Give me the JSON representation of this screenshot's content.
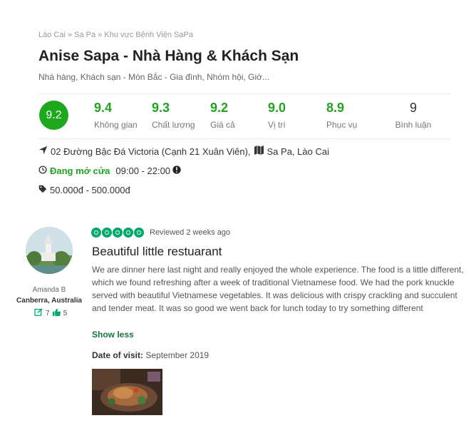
{
  "breadcrumb": {
    "items": [
      "Lào Cai",
      "Sa Pa",
      "Khu vực Bệnh Viện SaPa"
    ],
    "sep": " » "
  },
  "restaurant": {
    "title": "Anise Sapa - Nhà Hàng & Khách Sạn",
    "categories": "Nhà hàng, Khách sạn - Món Bắc - Gia đình, Nhóm hội, Giớ..."
  },
  "ratings": {
    "overall": "9.2",
    "items": [
      {
        "value": "9.4",
        "label": "Không gian"
      },
      {
        "value": "9.3",
        "label": "Chất lượng"
      },
      {
        "value": "9.2",
        "label": "Giá cả"
      },
      {
        "value": "9.0",
        "label": "Vị trí"
      },
      {
        "value": "8.9",
        "label": "Phục vụ"
      },
      {
        "value": "9",
        "label": "Bình luận"
      }
    ],
    "accent_color": "#22a322"
  },
  "info": {
    "address": "02 Đường Bậc Đá Victoria (Cạnh 21 Xuân Viên),",
    "city": "Sa Pa, Lào Cai",
    "status": "Đang mở cửa",
    "hours": "09:00 - 22:00",
    "price": "50.000đ - 500.000đ"
  },
  "review": {
    "user_name": "Amanda B",
    "user_location": "Canberra, Australia",
    "user_reviews": "7",
    "user_helpful": "5",
    "rating_bubbles": 5,
    "reviewed": "Reviewed 2 weeks ago",
    "title": "Beautiful little restuarant",
    "body": "We are dinner here last night and really enjoyed the whole experience. The food is a little different, which we found refreshing after a week of traditional Vietnamese food. We had the pork knuckle served with beautiful Vietnamese vegetables. It was delicious with crispy crackling and succulent and tender meat. It was so good we went back for lunch today to try something different",
    "show_less": "Show less",
    "visit_label": "Date of visit:",
    "visit_date": "September 2019",
    "bubble_color": "#00aa6c"
  }
}
